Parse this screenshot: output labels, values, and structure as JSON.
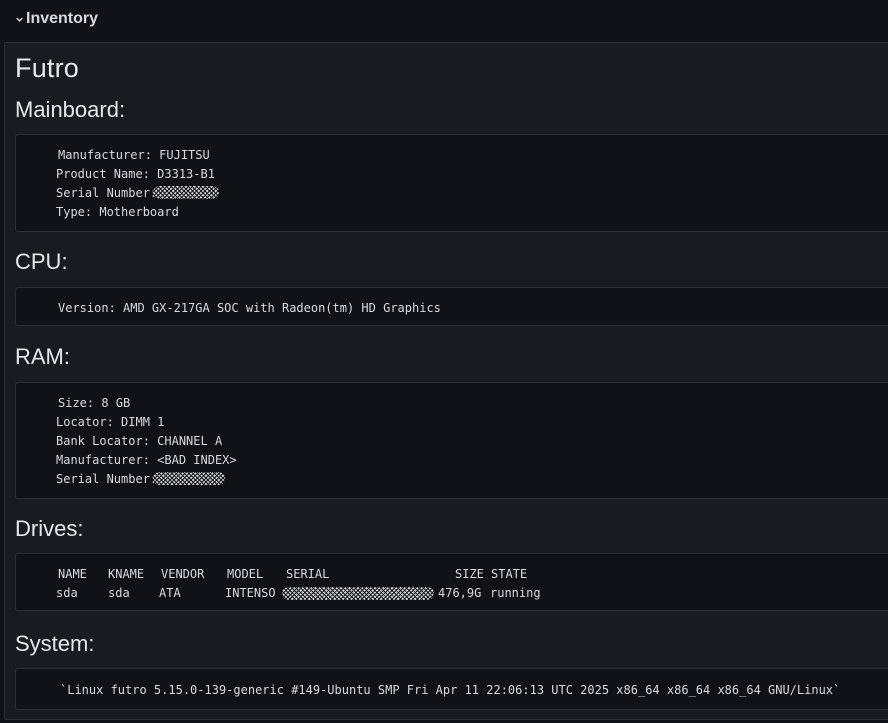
{
  "row": {
    "title": "Inventory",
    "collapse_icon": "chevron-down-icon"
  },
  "heading": "Futro",
  "mainboard": {
    "title": "Mainboard:",
    "manufacturer": "Manufacturer: FUJITSU",
    "product_name": "Product Name: D3313-B1",
    "serial_label": "Serial Number:",
    "type": "Type: Motherboard"
  },
  "cpu": {
    "title": "CPU:",
    "version": "Version: AMD GX-217GA SOC with Radeon(tm) HD Graphics"
  },
  "ram": {
    "title": "RAM:",
    "size": "Size: 8 GB",
    "locator": "Locator: DIMM 1",
    "bank_locator": "Bank Locator: CHANNEL A",
    "manufacturer": "Manufacturer: <BAD INDEX>",
    "serial_label": "Serial Number:"
  },
  "drives": {
    "title": "Drives:",
    "columns": [
      "NAME",
      "KNAME",
      "VENDOR",
      "MODEL",
      "SERIAL",
      "SIZE",
      "STATE"
    ],
    "rows": [
      {
        "name": "sda",
        "kname": "sda",
        "vendor": "ATA",
        "model": "INTENSO",
        "size": "476,9G",
        "state": "running"
      }
    ]
  },
  "system": {
    "title": "System:",
    "uname": "`Linux futro 5.15.0-139-generic #149-Ubuntu SMP Fri Apr 11 22:06:13 UTC 2025 x86_64 x86_64 x86_64 GNU/Linux`"
  },
  "colors": {
    "background": "#111217",
    "panel": "#181b1f",
    "border": "#2c2e33",
    "text": "#d8d9e3"
  }
}
